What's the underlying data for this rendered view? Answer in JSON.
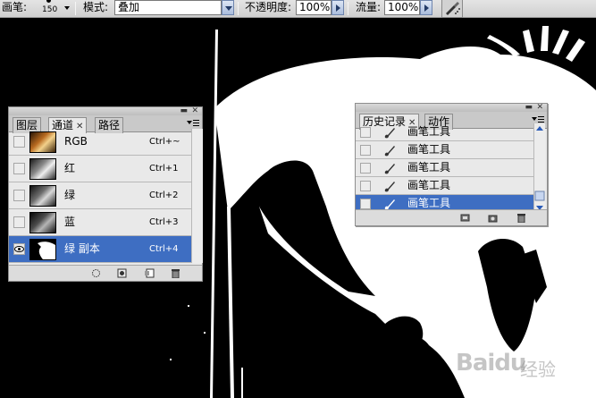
{
  "options_bar": {
    "brush_label": "画笔:",
    "brush_size": "150",
    "mode_label": "模式:",
    "mode_value": "叠加",
    "opacity_label": "不透明度:",
    "opacity_value": "100%",
    "flow_label": "流量:",
    "flow_value": "100%"
  },
  "channels_panel": {
    "tabs": [
      {
        "label": "图层",
        "closable": false
      },
      {
        "label": "通道",
        "closable": true
      },
      {
        "label": "路径",
        "closable": false
      }
    ],
    "active_tab": "通道",
    "channels": [
      {
        "name": "RGB",
        "shortcut": "Ctrl+~",
        "selected": false,
        "visible": false
      },
      {
        "name": "红",
        "shortcut": "Ctrl+1",
        "selected": false,
        "visible": false
      },
      {
        "name": "绿",
        "shortcut": "Ctrl+2",
        "selected": false,
        "visible": false
      },
      {
        "name": "蓝",
        "shortcut": "Ctrl+3",
        "selected": false,
        "visible": false
      },
      {
        "name": "绿 副本",
        "shortcut": "Ctrl+4",
        "selected": true,
        "visible": true
      }
    ]
  },
  "history_panel": {
    "tabs": [
      {
        "label": "历史记录",
        "closable": true
      },
      {
        "label": "动作",
        "closable": false
      }
    ],
    "active_tab": "历史记录",
    "states": [
      {
        "name": "画笔工具",
        "selected": false
      },
      {
        "name": "画笔工具",
        "selected": false
      },
      {
        "name": "画笔工具",
        "selected": false
      },
      {
        "name": "画笔工具",
        "selected": false
      },
      {
        "name": "画笔工具",
        "selected": true
      }
    ]
  },
  "watermark": {
    "brand": "Baidu",
    "suffix": "经验"
  },
  "colors": {
    "selection": "#3e6ec2",
    "panel_bg": "#e9e9e9"
  }
}
